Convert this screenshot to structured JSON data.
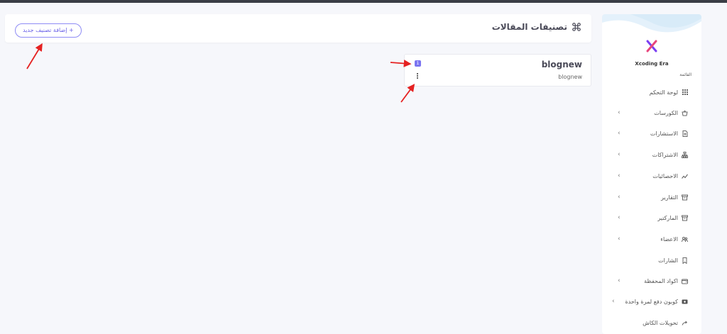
{
  "header": {
    "title": "تصنيفات المقالات",
    "add_button_label": "+ إضافة تصنيف جديد"
  },
  "category": {
    "name": "blognew",
    "slug": "blognew",
    "count_badge": "1"
  },
  "sidebar": {
    "brand": "Xcoding Era",
    "menu_caption": "القائمة",
    "items": [
      {
        "label": "لوحة التحكم",
        "icon": "grid-icon",
        "has_submenu": false
      },
      {
        "label": "الكورسات",
        "icon": "basket-icon",
        "has_submenu": true
      },
      {
        "label": "الاستشارات",
        "icon": "document-icon",
        "has_submenu": true
      },
      {
        "label": "الاشتراكات",
        "icon": "sitemap-icon",
        "has_submenu": true
      },
      {
        "label": "الاحصائيات",
        "icon": "chart-line-icon",
        "has_submenu": true
      },
      {
        "label": "التقارير",
        "icon": "archive-icon",
        "has_submenu": true
      },
      {
        "label": "الماركتير",
        "icon": "archive-icon",
        "has_submenu": true
      },
      {
        "label": "الاعضاء",
        "icon": "users-icon",
        "has_submenu": true
      },
      {
        "label": "الشارات",
        "icon": "bookmark-icon",
        "has_submenu": false
      },
      {
        "label": "اكواد المحفظة",
        "icon": "wallet-icon",
        "has_submenu": true
      },
      {
        "label": "كوبون دفع لمرة واحدة",
        "icon": "ticket-icon",
        "has_submenu": true
      },
      {
        "label": "تحويلات الكاش",
        "icon": "transfer-icon",
        "has_submenu": false
      }
    ]
  },
  "colors": {
    "accent": "#6c63e8",
    "badge": "#7b74f0",
    "annotation_arrow": "#e52222",
    "page_bg": "#f6f7fb"
  }
}
